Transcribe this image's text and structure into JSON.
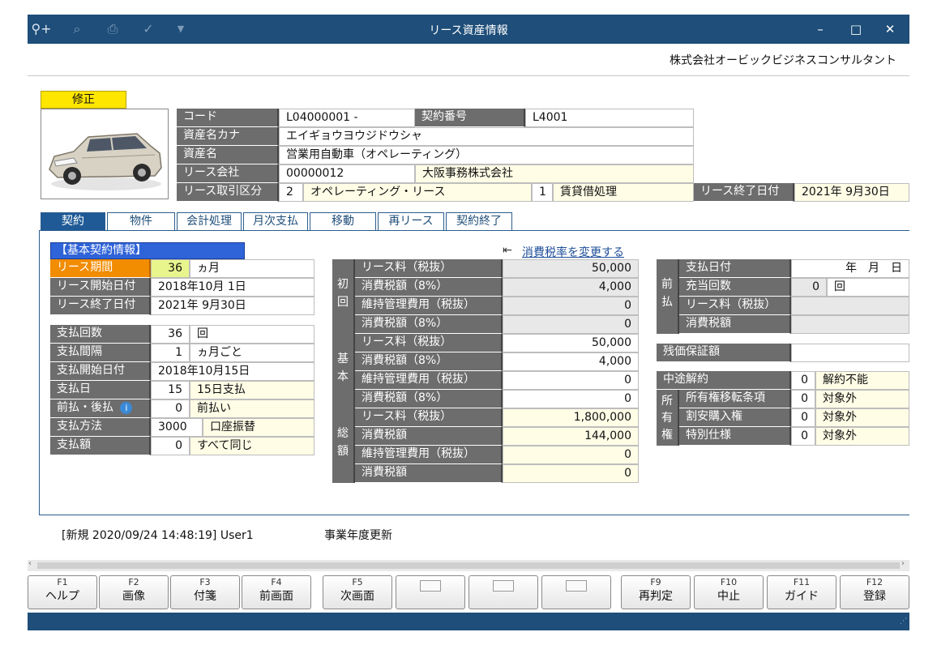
{
  "window": {
    "title": "リース資産情報",
    "toolbar_icons": [
      "zoom-in-icon",
      "zoom-search-icon",
      "print-icon",
      "approve-icon",
      "dropdown-icon"
    ],
    "controls": {
      "minimize": "–",
      "maximize": "□",
      "close": "✕"
    }
  },
  "company": "株式会社オービックビジネスコンサルタント",
  "mode": "修正",
  "header": {
    "code_label": "コード",
    "code_value": "L04000001  -",
    "contract_no_label": "契約番号",
    "contract_no_value": "L4001",
    "kana_label": "資産名カナ",
    "kana_value": "エイギョウヨウジドウシャ",
    "name_label": "資産名",
    "name_value": "営業用自動車（オペレーティング）",
    "lease_co_label": "リース会社",
    "lease_co_code": "00000012",
    "lease_co_name": "大阪事務株式会社",
    "lease_type_label": "リース取引区分",
    "lease_type_code": "2",
    "lease_type_name": "オペレーティング・リース",
    "accounting_code": "1",
    "accounting_name": "賃貸借処理",
    "end_date_label": "リース終了日付",
    "end_date_value": "2021年  9月30日"
  },
  "tabs": [
    "契約",
    "物件",
    "会計処理",
    "月次支払",
    "移動",
    "再リース",
    "契約終了"
  ],
  "basic": {
    "section_title": "【基本契約情報】",
    "period_label": "リース期間",
    "period_value": "36",
    "period_unit": "ヵ月",
    "start_label": "リース開始日付",
    "start_value": "2018年10月  1日",
    "end_label": "リース終了日付",
    "end_value": "2021年  9月30日",
    "pay_count_label": "支払回数",
    "pay_count_value": "36",
    "pay_count_unit": "回",
    "interval_label": "支払間隔",
    "interval_value": "1",
    "interval_unit": "ヵ月ごと",
    "pay_start_label": "支払開始日付",
    "pay_start_value": "2018年10月15日",
    "pay_day_label": "支払日",
    "pay_day_value": "15",
    "pay_day_text": "15日支払",
    "prepay_label": "前払・後払",
    "prepay_value": "0",
    "prepay_text": "前払い",
    "method_label": "支払方法",
    "method_code": "3000",
    "method_text": "口座振替",
    "amount_label": "支払額",
    "amount_value": "0",
    "amount_text": "すべて同じ"
  },
  "tax_link": "消費税率を変更する",
  "fees": {
    "groups": [
      {
        "label": "初回",
        "rows": [
          {
            "label": "リース料（税抜）",
            "value": "50,000",
            "style": "g"
          },
          {
            "label": "消費税額（8%）",
            "value": "4,000",
            "style": "g"
          },
          {
            "label": "維持管理費用（税抜）",
            "value": "0",
            "style": "g"
          },
          {
            "label": "消費税額（8%）",
            "value": "0",
            "style": "g"
          }
        ]
      },
      {
        "label": "基本",
        "rows": [
          {
            "label": "リース料（税抜）",
            "value": "50,000",
            "style": "w"
          },
          {
            "label": "消費税額（8%）",
            "value": "4,000",
            "style": "w"
          },
          {
            "label": "維持管理費用（税抜）",
            "value": "0",
            "style": "w"
          },
          {
            "label": "消費税額（8%）",
            "value": "0",
            "style": "w"
          }
        ]
      },
      {
        "label": "総額",
        "rows": [
          {
            "label": "リース料（税抜）",
            "value": "1,800,000",
            "style": "y"
          },
          {
            "label": "消費税額",
            "value": "144,000",
            "style": "y"
          },
          {
            "label": "維持管理費用（税抜）",
            "value": "0",
            "style": "y"
          },
          {
            "label": "消費税額",
            "value": "0",
            "style": "y"
          }
        ]
      }
    ]
  },
  "prepaid": {
    "group_label": "前払",
    "pay_date_label": "支払日付",
    "pay_date_value": "年　月　日",
    "count_label": "充当回数",
    "count_value": "0",
    "count_unit": "回",
    "fee_label": "リース料（税抜）",
    "tax_label": "消費税額"
  },
  "residual_label": "残価保証額",
  "cancel_label": "中途解約",
  "cancel_code": "0",
  "cancel_text": "解約不能",
  "ownership": {
    "group_label": "所有権",
    "rows": [
      {
        "label": "所有権移転条項",
        "code": "0",
        "text": "対象外"
      },
      {
        "label": "割安購入権",
        "code": "0",
        "text": "対象外"
      },
      {
        "label": "特別仕様",
        "code": "0",
        "text": "対象外"
      }
    ]
  },
  "status": {
    "record": "[新規  2020/09/24 14:48:19] User1",
    "note": "事業年度更新"
  },
  "fkeys": [
    {
      "code": "F1",
      "name": "ヘルプ"
    },
    {
      "code": "F2",
      "name": "画像"
    },
    {
      "code": "F3",
      "name": "付箋"
    },
    {
      "code": "F4",
      "name": "前画面"
    },
    {
      "code": "F5",
      "name": "次画面"
    },
    {
      "code": "",
      "name": ""
    },
    {
      "code": "",
      "name": ""
    },
    {
      "code": "",
      "name": ""
    },
    {
      "code": "F9",
      "name": "再判定"
    },
    {
      "code": "F10",
      "name": "中止"
    },
    {
      "code": "F11",
      "name": "ガイド"
    },
    {
      "code": "F12",
      "name": "登録"
    }
  ],
  "colors": {
    "titlebar": "#1e4e79",
    "label_gray": "#6d6d6d",
    "mode_yellow": "#ffe600",
    "section_blue": "#2f63d8",
    "active_tab": "#1f5a96",
    "highlight_orange": "#f28c00"
  }
}
